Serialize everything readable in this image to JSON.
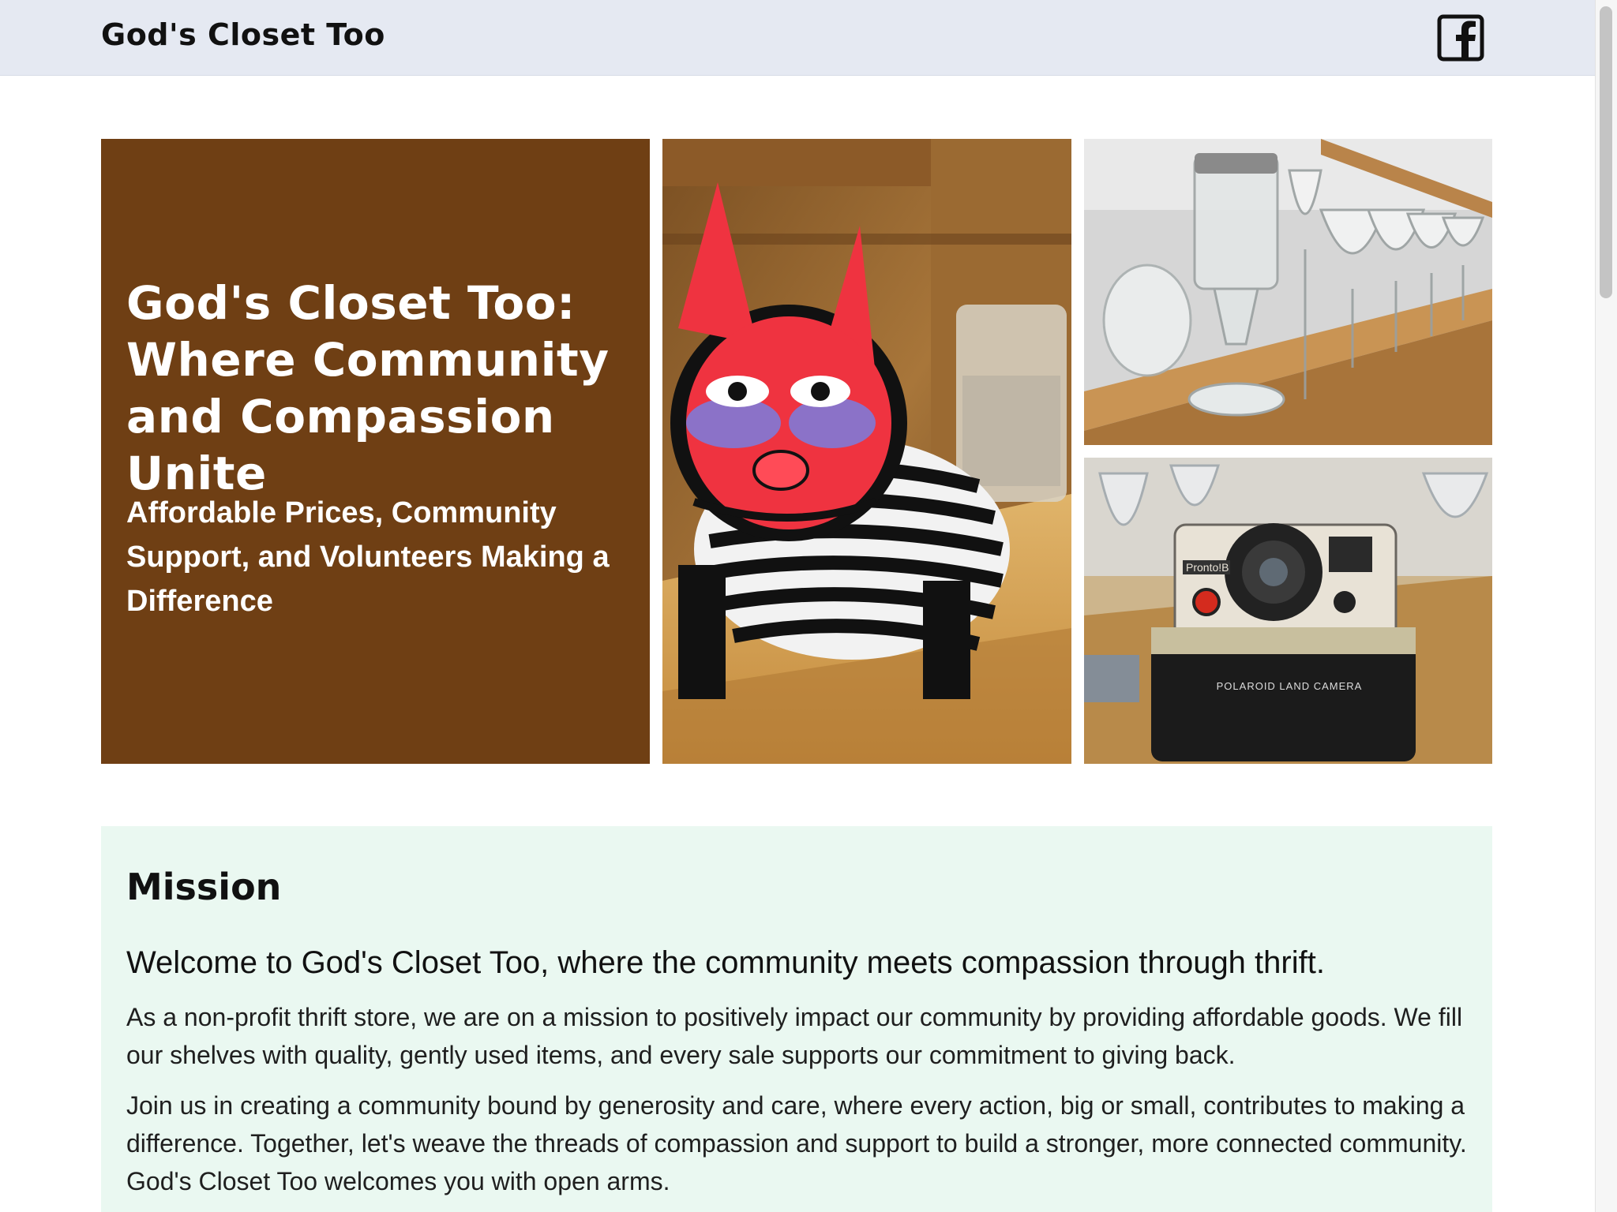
{
  "header": {
    "brand": "God's Closet Too",
    "facebook_icon": "facebook-icon"
  },
  "hero": {
    "title": "God's Closet Too: Where Community and Compassion Unite",
    "subtitle": "Affordable Prices, Community Support, and Volunteers Making a Difference",
    "background_color": "#6f3f14",
    "photos": [
      {
        "name": "striped-cat-figurine-photo"
      },
      {
        "name": "glassware-shelf-photo"
      },
      {
        "name": "polaroid-camera-photo",
        "camera_labels": [
          "Pronto!B",
          "POLAROID LAND CAMERA"
        ]
      }
    ]
  },
  "mission": {
    "heading": "Mission",
    "lead": "Welcome to God's Closet Too, where the community meets compassion through thrift.",
    "paragraph1": "As a non-profit thrift store, we are on a mission to positively impact our community by providing affordable goods. We fill our shelves with quality, gently used items, and every sale supports our commitment to giving back.",
    "paragraph2": "Join us in creating a community bound by generosity and care, where every action, big or small, contributes to making a difference. Together, let's weave the threads of compassion and support to build a stronger, more connected community. God's Closet Too welcomes you with open arms.",
    "background_color": "#eaf8f1"
  }
}
